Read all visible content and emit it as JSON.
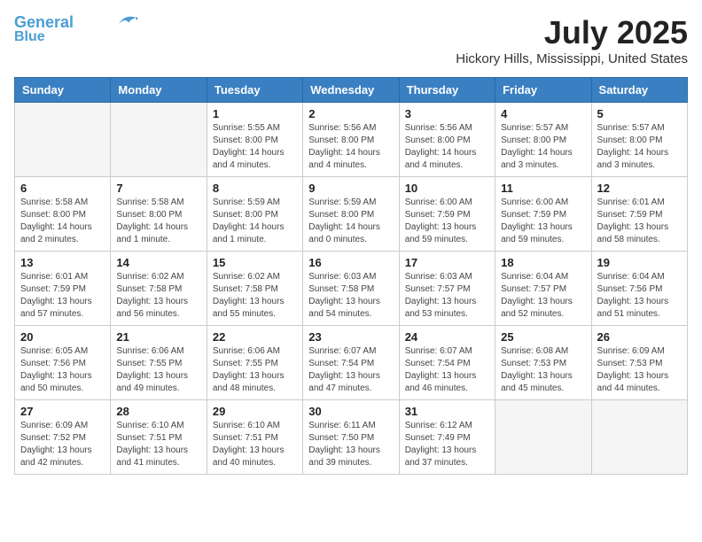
{
  "header": {
    "logo_line1": "General",
    "logo_line2": "Blue",
    "month": "July 2025",
    "location": "Hickory Hills, Mississippi, United States"
  },
  "weekdays": [
    "Sunday",
    "Monday",
    "Tuesday",
    "Wednesday",
    "Thursday",
    "Friday",
    "Saturday"
  ],
  "weeks": [
    [
      {
        "day": "",
        "info": ""
      },
      {
        "day": "",
        "info": ""
      },
      {
        "day": "1",
        "info": "Sunrise: 5:55 AM\nSunset: 8:00 PM\nDaylight: 14 hours\nand 4 minutes."
      },
      {
        "day": "2",
        "info": "Sunrise: 5:56 AM\nSunset: 8:00 PM\nDaylight: 14 hours\nand 4 minutes."
      },
      {
        "day": "3",
        "info": "Sunrise: 5:56 AM\nSunset: 8:00 PM\nDaylight: 14 hours\nand 4 minutes."
      },
      {
        "day": "4",
        "info": "Sunrise: 5:57 AM\nSunset: 8:00 PM\nDaylight: 14 hours\nand 3 minutes."
      },
      {
        "day": "5",
        "info": "Sunrise: 5:57 AM\nSunset: 8:00 PM\nDaylight: 14 hours\nand 3 minutes."
      }
    ],
    [
      {
        "day": "6",
        "info": "Sunrise: 5:58 AM\nSunset: 8:00 PM\nDaylight: 14 hours\nand 2 minutes."
      },
      {
        "day": "7",
        "info": "Sunrise: 5:58 AM\nSunset: 8:00 PM\nDaylight: 14 hours\nand 1 minute."
      },
      {
        "day": "8",
        "info": "Sunrise: 5:59 AM\nSunset: 8:00 PM\nDaylight: 14 hours\nand 1 minute."
      },
      {
        "day": "9",
        "info": "Sunrise: 5:59 AM\nSunset: 8:00 PM\nDaylight: 14 hours\nand 0 minutes."
      },
      {
        "day": "10",
        "info": "Sunrise: 6:00 AM\nSunset: 7:59 PM\nDaylight: 13 hours\nand 59 minutes."
      },
      {
        "day": "11",
        "info": "Sunrise: 6:00 AM\nSunset: 7:59 PM\nDaylight: 13 hours\nand 59 minutes."
      },
      {
        "day": "12",
        "info": "Sunrise: 6:01 AM\nSunset: 7:59 PM\nDaylight: 13 hours\nand 58 minutes."
      }
    ],
    [
      {
        "day": "13",
        "info": "Sunrise: 6:01 AM\nSunset: 7:59 PM\nDaylight: 13 hours\nand 57 minutes."
      },
      {
        "day": "14",
        "info": "Sunrise: 6:02 AM\nSunset: 7:58 PM\nDaylight: 13 hours\nand 56 minutes."
      },
      {
        "day": "15",
        "info": "Sunrise: 6:02 AM\nSunset: 7:58 PM\nDaylight: 13 hours\nand 55 minutes."
      },
      {
        "day": "16",
        "info": "Sunrise: 6:03 AM\nSunset: 7:58 PM\nDaylight: 13 hours\nand 54 minutes."
      },
      {
        "day": "17",
        "info": "Sunrise: 6:03 AM\nSunset: 7:57 PM\nDaylight: 13 hours\nand 53 minutes."
      },
      {
        "day": "18",
        "info": "Sunrise: 6:04 AM\nSunset: 7:57 PM\nDaylight: 13 hours\nand 52 minutes."
      },
      {
        "day": "19",
        "info": "Sunrise: 6:04 AM\nSunset: 7:56 PM\nDaylight: 13 hours\nand 51 minutes."
      }
    ],
    [
      {
        "day": "20",
        "info": "Sunrise: 6:05 AM\nSunset: 7:56 PM\nDaylight: 13 hours\nand 50 minutes."
      },
      {
        "day": "21",
        "info": "Sunrise: 6:06 AM\nSunset: 7:55 PM\nDaylight: 13 hours\nand 49 minutes."
      },
      {
        "day": "22",
        "info": "Sunrise: 6:06 AM\nSunset: 7:55 PM\nDaylight: 13 hours\nand 48 minutes."
      },
      {
        "day": "23",
        "info": "Sunrise: 6:07 AM\nSunset: 7:54 PM\nDaylight: 13 hours\nand 47 minutes."
      },
      {
        "day": "24",
        "info": "Sunrise: 6:07 AM\nSunset: 7:54 PM\nDaylight: 13 hours\nand 46 minutes."
      },
      {
        "day": "25",
        "info": "Sunrise: 6:08 AM\nSunset: 7:53 PM\nDaylight: 13 hours\nand 45 minutes."
      },
      {
        "day": "26",
        "info": "Sunrise: 6:09 AM\nSunset: 7:53 PM\nDaylight: 13 hours\nand 44 minutes."
      }
    ],
    [
      {
        "day": "27",
        "info": "Sunrise: 6:09 AM\nSunset: 7:52 PM\nDaylight: 13 hours\nand 42 minutes."
      },
      {
        "day": "28",
        "info": "Sunrise: 6:10 AM\nSunset: 7:51 PM\nDaylight: 13 hours\nand 41 minutes."
      },
      {
        "day": "29",
        "info": "Sunrise: 6:10 AM\nSunset: 7:51 PM\nDaylight: 13 hours\nand 40 minutes."
      },
      {
        "day": "30",
        "info": "Sunrise: 6:11 AM\nSunset: 7:50 PM\nDaylight: 13 hours\nand 39 minutes."
      },
      {
        "day": "31",
        "info": "Sunrise: 6:12 AM\nSunset: 7:49 PM\nDaylight: 13 hours\nand 37 minutes."
      },
      {
        "day": "",
        "info": ""
      },
      {
        "day": "",
        "info": ""
      }
    ]
  ]
}
